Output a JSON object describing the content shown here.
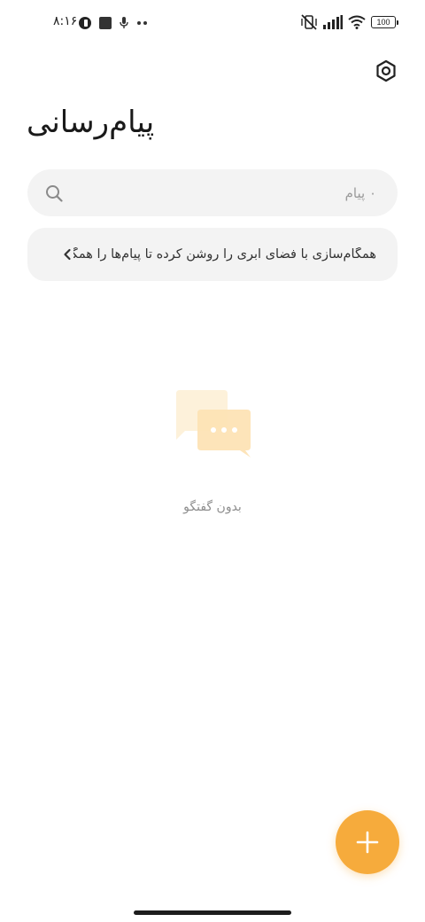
{
  "status_bar": {
    "time": "۸:۱۶",
    "battery_level": "100",
    "icons": [
      "radio-icon",
      "notification-square-icon",
      "microphone-icon",
      "more-dots-icon",
      "vibrate-off-icon",
      "signal-icon",
      "wifi-icon",
      "battery-icon"
    ]
  },
  "header": {
    "title": "پیام‌رسانی",
    "settings_icon": "settings-hexagon-icon"
  },
  "search": {
    "placeholder": "۰ پیام",
    "value": "",
    "icon": "search-icon"
  },
  "sync_banner": {
    "text": "همگام‌سازی با فضای ابری را روشن کرده تا پیام‌ها را همگام‌سازی کنید",
    "icon": "chevron-left-icon"
  },
  "empty_state": {
    "icon": "chat-bubbles-icon",
    "text": "بدون گفتگو"
  },
  "fab": {
    "icon": "plus-icon"
  },
  "colors": {
    "accent": "#f6ab3c",
    "surface": "#f3f3f3",
    "text_secondary": "#8e8e8e"
  }
}
